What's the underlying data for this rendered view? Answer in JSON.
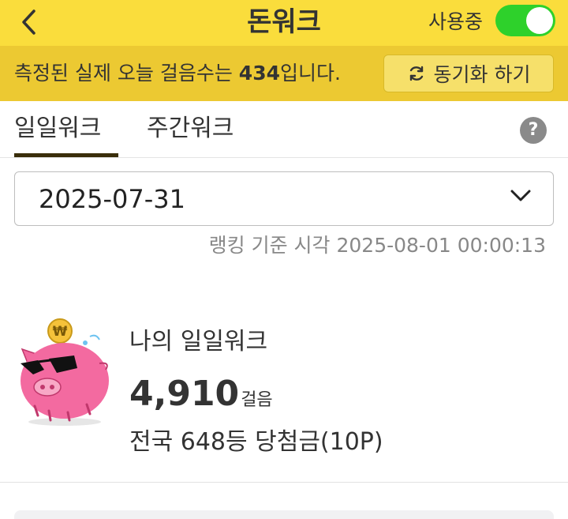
{
  "header": {
    "title": "돈워크",
    "toggle_label": "사용중",
    "toggle_on": true,
    "accent_color": "#fadd3c",
    "toggle_color": "#2ed12b"
  },
  "banner": {
    "text_before": "측정된 실제 오늘 걸음수는 ",
    "step_count": "434",
    "text_after": "입니다.",
    "sync_label": "동기화 하기",
    "background_color": "#ecc932"
  },
  "tabs": [
    {
      "label": "일일워크",
      "active": true
    },
    {
      "label": "주간워크",
      "active": false
    }
  ],
  "help": {
    "icon": "question-circle-icon",
    "glyph": "?"
  },
  "date_select": {
    "value": "2025-07-31",
    "icon": "chevron-down-icon"
  },
  "ranking_time": "랭킹 기준 시각 2025-08-01 00:00:13",
  "my_walk": {
    "title": "나의 일일워크",
    "steps": "4,910",
    "steps_unit": "걸음",
    "rank_text": "전국 648등 당첨금(10P)",
    "coin_symbol": "₩",
    "mascot_icon": "pig-with-sunglasses-icon"
  }
}
